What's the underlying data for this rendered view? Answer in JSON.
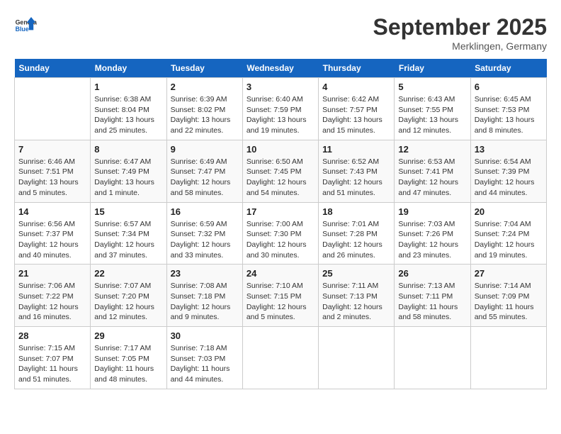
{
  "header": {
    "logo_general": "General",
    "logo_blue": "Blue",
    "month": "September 2025",
    "location": "Merklingen, Germany"
  },
  "days_of_week": [
    "Sunday",
    "Monday",
    "Tuesday",
    "Wednesday",
    "Thursday",
    "Friday",
    "Saturday"
  ],
  "weeks": [
    [
      {
        "day": "",
        "info": ""
      },
      {
        "day": "1",
        "info": "Sunrise: 6:38 AM\nSunset: 8:04 PM\nDaylight: 13 hours and 25 minutes."
      },
      {
        "day": "2",
        "info": "Sunrise: 6:39 AM\nSunset: 8:02 PM\nDaylight: 13 hours and 22 minutes."
      },
      {
        "day": "3",
        "info": "Sunrise: 6:40 AM\nSunset: 7:59 PM\nDaylight: 13 hours and 19 minutes."
      },
      {
        "day": "4",
        "info": "Sunrise: 6:42 AM\nSunset: 7:57 PM\nDaylight: 13 hours and 15 minutes."
      },
      {
        "day": "5",
        "info": "Sunrise: 6:43 AM\nSunset: 7:55 PM\nDaylight: 13 hours and 12 minutes."
      },
      {
        "day": "6",
        "info": "Sunrise: 6:45 AM\nSunset: 7:53 PM\nDaylight: 13 hours and 8 minutes."
      }
    ],
    [
      {
        "day": "7",
        "info": "Sunrise: 6:46 AM\nSunset: 7:51 PM\nDaylight: 13 hours and 5 minutes."
      },
      {
        "day": "8",
        "info": "Sunrise: 6:47 AM\nSunset: 7:49 PM\nDaylight: 13 hours and 1 minute."
      },
      {
        "day": "9",
        "info": "Sunrise: 6:49 AM\nSunset: 7:47 PM\nDaylight: 12 hours and 58 minutes."
      },
      {
        "day": "10",
        "info": "Sunrise: 6:50 AM\nSunset: 7:45 PM\nDaylight: 12 hours and 54 minutes."
      },
      {
        "day": "11",
        "info": "Sunrise: 6:52 AM\nSunset: 7:43 PM\nDaylight: 12 hours and 51 minutes."
      },
      {
        "day": "12",
        "info": "Sunrise: 6:53 AM\nSunset: 7:41 PM\nDaylight: 12 hours and 47 minutes."
      },
      {
        "day": "13",
        "info": "Sunrise: 6:54 AM\nSunset: 7:39 PM\nDaylight: 12 hours and 44 minutes."
      }
    ],
    [
      {
        "day": "14",
        "info": "Sunrise: 6:56 AM\nSunset: 7:37 PM\nDaylight: 12 hours and 40 minutes."
      },
      {
        "day": "15",
        "info": "Sunrise: 6:57 AM\nSunset: 7:34 PM\nDaylight: 12 hours and 37 minutes."
      },
      {
        "day": "16",
        "info": "Sunrise: 6:59 AM\nSunset: 7:32 PM\nDaylight: 12 hours and 33 minutes."
      },
      {
        "day": "17",
        "info": "Sunrise: 7:00 AM\nSunset: 7:30 PM\nDaylight: 12 hours and 30 minutes."
      },
      {
        "day": "18",
        "info": "Sunrise: 7:01 AM\nSunset: 7:28 PM\nDaylight: 12 hours and 26 minutes."
      },
      {
        "day": "19",
        "info": "Sunrise: 7:03 AM\nSunset: 7:26 PM\nDaylight: 12 hours and 23 minutes."
      },
      {
        "day": "20",
        "info": "Sunrise: 7:04 AM\nSunset: 7:24 PM\nDaylight: 12 hours and 19 minutes."
      }
    ],
    [
      {
        "day": "21",
        "info": "Sunrise: 7:06 AM\nSunset: 7:22 PM\nDaylight: 12 hours and 16 minutes."
      },
      {
        "day": "22",
        "info": "Sunrise: 7:07 AM\nSunset: 7:20 PM\nDaylight: 12 hours and 12 minutes."
      },
      {
        "day": "23",
        "info": "Sunrise: 7:08 AM\nSunset: 7:18 PM\nDaylight: 12 hours and 9 minutes."
      },
      {
        "day": "24",
        "info": "Sunrise: 7:10 AM\nSunset: 7:15 PM\nDaylight: 12 hours and 5 minutes."
      },
      {
        "day": "25",
        "info": "Sunrise: 7:11 AM\nSunset: 7:13 PM\nDaylight: 12 hours and 2 minutes."
      },
      {
        "day": "26",
        "info": "Sunrise: 7:13 AM\nSunset: 7:11 PM\nDaylight: 11 hours and 58 minutes."
      },
      {
        "day": "27",
        "info": "Sunrise: 7:14 AM\nSunset: 7:09 PM\nDaylight: 11 hours and 55 minutes."
      }
    ],
    [
      {
        "day": "28",
        "info": "Sunrise: 7:15 AM\nSunset: 7:07 PM\nDaylight: 11 hours and 51 minutes."
      },
      {
        "day": "29",
        "info": "Sunrise: 7:17 AM\nSunset: 7:05 PM\nDaylight: 11 hours and 48 minutes."
      },
      {
        "day": "30",
        "info": "Sunrise: 7:18 AM\nSunset: 7:03 PM\nDaylight: 11 hours and 44 minutes."
      },
      {
        "day": "",
        "info": ""
      },
      {
        "day": "",
        "info": ""
      },
      {
        "day": "",
        "info": ""
      },
      {
        "day": "",
        "info": ""
      }
    ]
  ]
}
